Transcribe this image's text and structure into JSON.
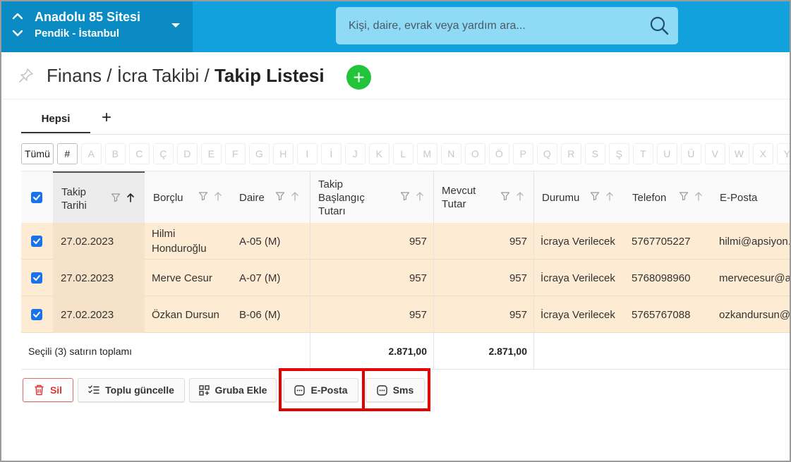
{
  "header": {
    "site_name": "Anadolu 85 Sitesi",
    "site_location": "Pendik - İstanbul",
    "search_placeholder": "Kişi, daire, evrak veya yardım ara..."
  },
  "breadcrumb": {
    "part1": "Finans",
    "sep": " / ",
    "part2": "İcra Takibi",
    "current": "Takip Listesi"
  },
  "tabs": {
    "active": "Hepsi",
    "add": "+"
  },
  "letter_filter": {
    "all": "Tümü",
    "hash": "#",
    "letters": [
      "A",
      "B",
      "C",
      "Ç",
      "D",
      "E",
      "F",
      "G",
      "H",
      "I",
      "İ",
      "J",
      "K",
      "L",
      "M",
      "N",
      "O",
      "Ö",
      "P",
      "Q",
      "R",
      "S",
      "Ş",
      "T",
      "U",
      "Ü",
      "V",
      "W",
      "X",
      "Y"
    ]
  },
  "table": {
    "columns": {
      "takip_tarihi": "Takip Tarihi",
      "borclu": "Borçlu",
      "daire": "Daire",
      "baslangic": "Takip Başlangıç Tutarı",
      "mevcut": "Mevcut Tutar",
      "durumu": "Durumu",
      "telefon": "Telefon",
      "eposta": "E-Posta"
    },
    "rows": [
      {
        "tarih": "27.02.2023",
        "borclu": "Hilmi Honduroğlu",
        "daire": "A-05 (M)",
        "baslangic": "957",
        "mevcut": "957",
        "durum": "İcraya Verilecek",
        "telefon": "5767705227",
        "eposta": "hilmi@apsiyon.com"
      },
      {
        "tarih": "27.02.2023",
        "borclu": "Merve Cesur",
        "daire": "A-07 (M)",
        "baslangic": "957",
        "mevcut": "957",
        "durum": "İcraya Verilecek",
        "telefon": "5768098960",
        "eposta": "mervecesur@apsiyon.com"
      },
      {
        "tarih": "27.02.2023",
        "borclu": "Özkan Dursun",
        "daire": "B-06 (M)",
        "baslangic": "957",
        "mevcut": "957",
        "durum": "İcraya Verilecek",
        "telefon": "5765767088",
        "eposta": "ozkandursun@apsiyon.com"
      }
    ],
    "footer": {
      "label": "Seçili (3) satırın toplamı",
      "baslangic_total": "2.871,00",
      "mevcut_total": "2.871,00"
    }
  },
  "actions": {
    "delete": "Sil",
    "bulk_update": "Toplu güncelle",
    "add_group": "Gruba Ekle",
    "email": "E-Posta",
    "sms": "Sms"
  },
  "colors": {
    "header_bg": "#11a1dd",
    "site_switch_bg": "#0a8bc3",
    "selected_row_bg": "#fdebd3",
    "checkbox": "#1a73e8",
    "add_button": "#22c43a",
    "highlight": "#e50000"
  }
}
